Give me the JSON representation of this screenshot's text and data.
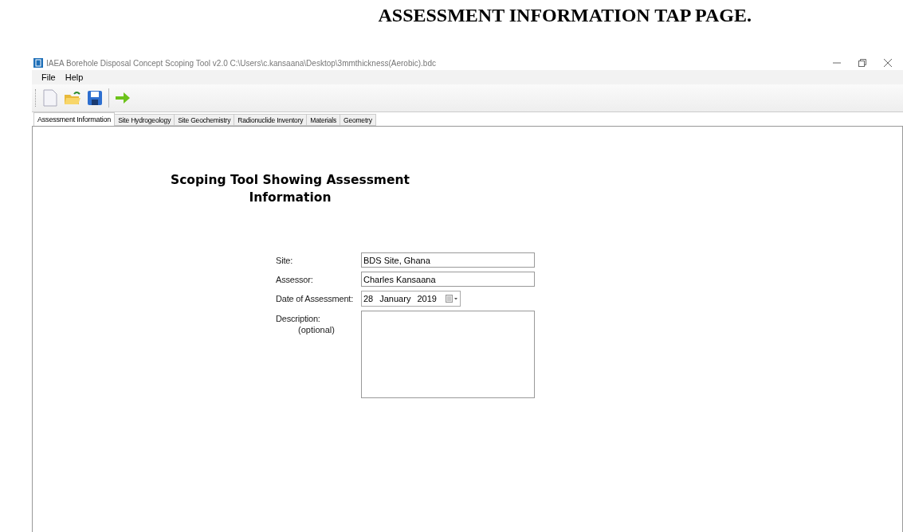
{
  "document_heading": "ASSESSMENT INFORMATION TAP PAGE.",
  "window": {
    "title": "IAEA Borehole Disposal Concept Scoping Tool v2.0 C:\\Users\\c.kansaana\\Desktop\\3mmthickness(Aerobic).bdc"
  },
  "menu": [
    "File",
    "Help"
  ],
  "tabs": [
    {
      "label": "Assessment Information",
      "selected": true
    },
    {
      "label": "Site Hydrogeology",
      "selected": false
    },
    {
      "label": "Site Geochemistry",
      "selected": false
    },
    {
      "label": "Radionuclide Inventory",
      "selected": false
    },
    {
      "label": "Materials",
      "selected": false
    },
    {
      "label": "Geometry",
      "selected": false
    }
  ],
  "form": {
    "title": "Scoping Tool Showing Assessment Information",
    "fields": [
      {
        "kind": "text",
        "label": "Site:",
        "value": "BDS Site, Ghana"
      },
      {
        "kind": "text",
        "label": "Assessor:",
        "value": "Charles Kansaana"
      },
      {
        "kind": "date",
        "label": "Date of Assessment:",
        "day": "28",
        "month": "January",
        "year": "2019"
      },
      {
        "kind": "textarea",
        "label": "Description:",
        "sublabel": "(optional)"
      }
    ]
  }
}
